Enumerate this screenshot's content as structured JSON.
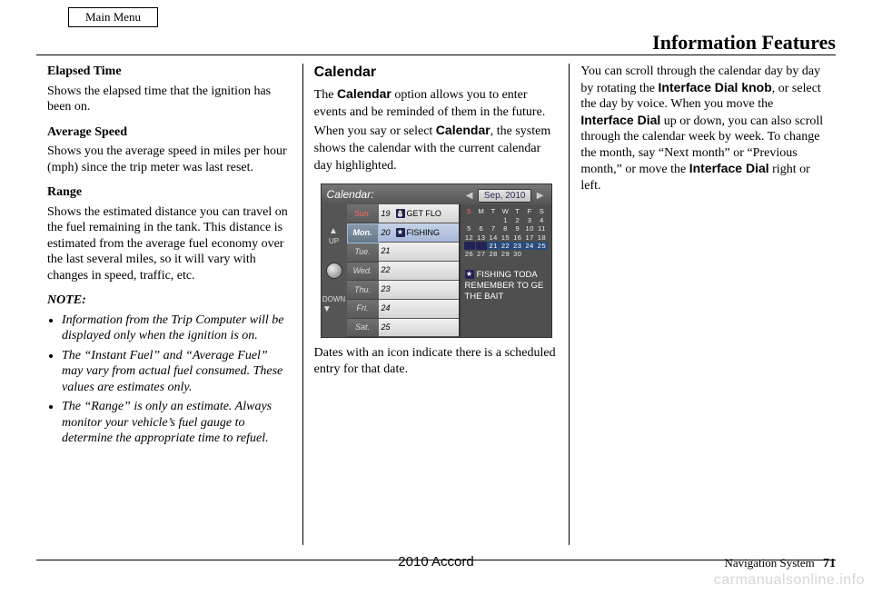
{
  "main_menu": "Main Menu",
  "header": "Information Features",
  "col1": {
    "elapsed_head": "Elapsed Time",
    "elapsed_body": "Shows the elapsed time that the ignition has been on.",
    "avg_head": "Average Speed",
    "avg_body": "Shows you the average speed in miles per hour (mph) since the trip meter was last reset.",
    "range_head": "Range",
    "range_body": "Shows the estimated distance you can travel on the fuel remaining in the tank. This distance is estimated from the average fuel economy over the last several miles, so it will vary with changes in speed, traffic, etc.",
    "note_head": "NOTE:",
    "note_items": [
      "Information from the Trip Computer will be displayed only when the ignition is on.",
      "The “Instant Fuel” and “Average Fuel” may vary from actual fuel consumed. These values are estimates only.",
      "The “Range” is only an estimate. Always monitor your vehicle’s fuel gauge to determine the appropriate time to refuel."
    ]
  },
  "col2": {
    "heading": "Calendar",
    "p1a": "The ",
    "p1b": "Calendar",
    "p1c": " option allows you to enter events and be reminded of them in the future. When you say or select ",
    "p1d": "Calendar",
    "p1e": ", the system shows the calendar with the current calendar day highlighted.",
    "caption": "Dates with an icon indicate there is a scheduled entry for that date."
  },
  "screen": {
    "title": "Calendar:",
    "month": "Sep, 2010",
    "days": [
      "Sun.",
      "Mon.",
      "Tue.",
      "Wed.",
      "Thu.",
      "Fri.",
      "Sat."
    ],
    "rows": [
      {
        "num": "19",
        "icon": "person",
        "text": "GET FLO"
      },
      {
        "num": "20",
        "icon": "star",
        "text": "FISHING"
      },
      {
        "num": "21",
        "icon": "",
        "text": ""
      },
      {
        "num": "22",
        "icon": "",
        "text": ""
      },
      {
        "num": "23",
        "icon": "",
        "text": ""
      },
      {
        "num": "24",
        "icon": "",
        "text": ""
      },
      {
        "num": "25",
        "icon": "",
        "text": ""
      }
    ],
    "mini_header": [
      "S",
      "M",
      "T",
      "W",
      "T",
      "F",
      "S"
    ],
    "mini_rows": [
      [
        "",
        "",
        "",
        "1",
        "2",
        "3",
        "4"
      ],
      [
        "5",
        "6",
        "7",
        "8",
        "9",
        "10",
        "11"
      ],
      [
        "12",
        "13",
        "14",
        "15",
        "16",
        "17",
        "18"
      ],
      [
        "",
        "",
        "21",
        "22",
        "23",
        "24",
        "25"
      ],
      [
        "26",
        "27",
        "28",
        "29",
        "30",
        "",
        ""
      ]
    ],
    "note_line1": "FISHING TODA",
    "note_line2": "REMEMBER TO GE",
    "note_line3": "THE BAIT",
    "up": "UP",
    "down": "DOWN"
  },
  "col3": {
    "p_a": "You can scroll through the calendar day by day by rotating the ",
    "p_b": "Interface Dial knob",
    "p_c": ", or select the day by voice. When you move the ",
    "p_d": "Interface Dial",
    "p_e": " up or down, you can also scroll through the calendar week by week. To change the month, say “Next month” or “Previous month,” or move the ",
    "p_f": "Interface Dial",
    "p_g": " right or left."
  },
  "footer": {
    "center": "2010 Accord",
    "right_label": "Navigation System",
    "right_page": "71"
  },
  "watermark": "carmanualsonline.info"
}
